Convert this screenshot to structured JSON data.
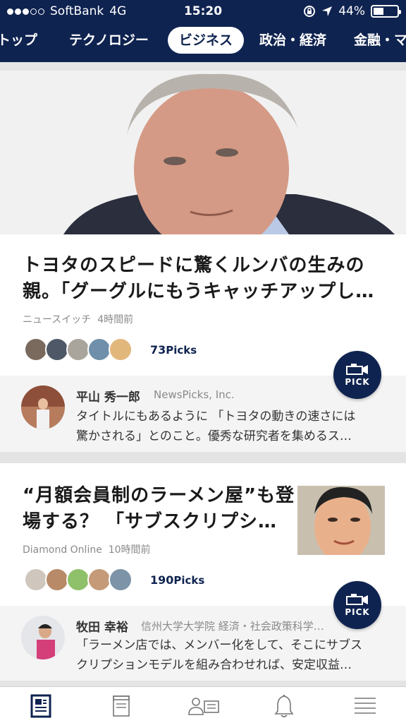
{
  "status_bar": {
    "carrier": "SoftBank",
    "network": "4G",
    "time": "15:20",
    "battery_percent": "44%",
    "battery_level": 0.44
  },
  "tabs": [
    {
      "label": "トップ",
      "active": false
    },
    {
      "label": "テクノロジー",
      "active": false
    },
    {
      "label": "ビジネス",
      "active": true
    },
    {
      "label": "政治・経済",
      "active": false
    },
    {
      "label": "金融・マ",
      "active": false
    }
  ],
  "articles": [
    {
      "headline_line1": "トヨタのスピードに驚くルンバの生みの",
      "headline_line2": "親。「グーグルにもうキャッチアップし…",
      "source": "ニュースイッチ",
      "time": "4時間前",
      "picks": "73",
      "picks_suffix": "Picks",
      "pick_button": "PICK",
      "comment": {
        "name": "平山 秀一郎",
        "org": "NewsPicks, Inc.",
        "text_line1": "タイトルにもあるように 「トヨタの動きの速さには",
        "text_line2": "驚かされる」とのこと。優秀な研究者を集めるス…"
      }
    },
    {
      "headline_line1": "“月額会員制のラーメン屋”も登",
      "headline_line2": "場する？ 「サブスクリプシ…",
      "source": "Diamond Online",
      "time": "10時間前",
      "picks": "190",
      "picks_suffix": "Picks",
      "pick_button": "PICK",
      "comment": {
        "name": "牧田 幸裕",
        "org": "信州大学大学院 経済・社会政策科学…",
        "text_line1": "「ラーメン店では、メンバー化をして、そこにサブス",
        "text_line2": "クリプションモデルを組み合わせれば、安定収益…"
      }
    }
  ],
  "bottom_nav": [
    {
      "icon": "news-icon",
      "active": true
    },
    {
      "icon": "book-icon",
      "active": false
    },
    {
      "icon": "people-icon",
      "active": false
    },
    {
      "icon": "bell-icon",
      "active": false
    },
    {
      "icon": "menu-icon",
      "active": false
    }
  ],
  "colors": {
    "navy": "#0f2350",
    "divider": "#e4e4e4",
    "comment_bg": "#f4f4f4"
  }
}
